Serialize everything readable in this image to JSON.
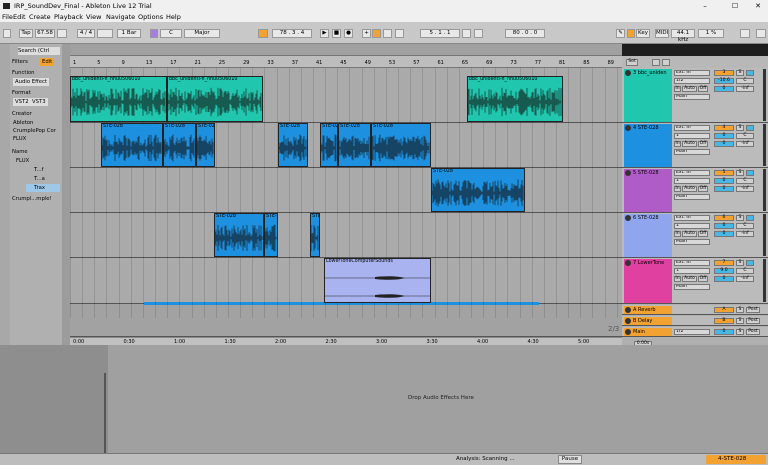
{
  "window": {
    "title": "IRP_SoundDev_Final - Ableton Live 12 Trial",
    "minimize": "–",
    "maximize": "☐",
    "close": "✕"
  },
  "menu": [
    "File",
    "Edit",
    "Create",
    "Playback",
    "View",
    "Navigate",
    "Options",
    "Help"
  ],
  "toolbar": {
    "tap": "Tap",
    "tempo": "67.58",
    "sig": "4 / 4",
    "metro": "1 Bar",
    "key": "C",
    "scale": "Major",
    "position": "78 . 3 . 4",
    "loop_start": "5 . 1 . 1",
    "loop_len": "80 . 0 . 0",
    "key_btn": "Key",
    "midi": "MIDI",
    "sample_rate": "44.1 kHz",
    "cpu": "1 %"
  },
  "browser": {
    "search": "Search (Ctrl",
    "items": [
      "Filters",
      "Edit",
      "Function",
      "Audio Effect",
      "Format",
      "VST2",
      "VST3",
      "Creator",
      "Ableton",
      "CrumplePop Cor",
      "FLUX",
      "Name",
      "FLUX",
      "T...f",
      "T...a",
      "Trax",
      "Crumpl...mple!"
    ]
  },
  "ruler_ticks": [
    "1",
    "5",
    "9",
    "13",
    "17",
    "21",
    "25",
    "29",
    "33",
    "37",
    "41",
    "45",
    "49",
    "53",
    "57",
    "61",
    "65",
    "69",
    "73",
    "77",
    "81",
    "85",
    "89"
  ],
  "timeline": [
    "0:00",
    "0:30",
    "1:00",
    "1:30",
    "2:00",
    "2:30",
    "3:00",
    "3:30",
    "4:00",
    "4:30",
    "5:00"
  ],
  "clips": {
    "c1": "bbc_unidenti-fi_nhu0506010",
    "c2": "bbc_unidenti-fi_nhu0506010",
    "c3": "bbc_unidenti-fi_nhu0506010",
    "s1": "STE-028",
    "s2": "STE-028",
    "s3": "STE-028",
    "s4": "STE-028",
    "s5": "STE-028",
    "s6": "STE-028",
    "s7": "STE-028",
    "s8": "STE-028",
    "s9": "STE-028",
    "s10": "STE-028",
    "s11": "STE",
    "low": "LowerToneComputerSounds"
  },
  "tracks": [
    {
      "name": "3 bbc_uniden",
      "color": "#20c7ae",
      "input": "Ext. In",
      "ch": "1/2",
      "mon": "Auto",
      "out": "Main",
      "num": "3",
      "vol": "-10.6",
      "pan": "C"
    },
    {
      "name": "4 STE-028",
      "color": "#1e90e0",
      "input": "Ext. In",
      "ch": "1",
      "mon": "Auto",
      "out": "Main",
      "num": "4",
      "vol": "0",
      "pan": "C"
    },
    {
      "name": "5 STE-028",
      "color": "#b05cc8",
      "input": "Ext. In",
      "ch": "1",
      "mon": "Auto",
      "out": "Main",
      "num": "5",
      "vol": "0",
      "pan": "C"
    },
    {
      "name": "6 STE-028",
      "color": "#8fa5ee",
      "input": "Ext. In",
      "ch": "1",
      "mon": "Auto",
      "out": "Main",
      "num": "6",
      "vol": "0",
      "pan": "C"
    },
    {
      "name": "7 LowerTone",
      "color": "#e040a0",
      "input": "Ext. In",
      "ch": "1",
      "mon": "Auto",
      "out": "Main",
      "num": "7",
      "vol": "9.0",
      "pan": "C"
    }
  ],
  "returns": [
    {
      "name": "A Reverb",
      "letter": "A",
      "color": "#f2a230"
    },
    {
      "name": "B Delay",
      "letter": "B",
      "color": "#f2a230"
    },
    {
      "name": "Main",
      "letter": "",
      "color": "#f2a230"
    }
  ],
  "misc": {
    "set": "Set",
    "fraction": "2/3",
    "zero": "0",
    "main_sel": "1/2",
    "oos": "0.00s",
    "solo": "S",
    "post": "Post",
    "inf": "-inf",
    "offbtn": "Off",
    "inlabel": "In"
  },
  "device": {
    "drop": "Drop Audio Effects Here"
  },
  "status": {
    "analysis": "Analysis: Scanning ...",
    "pause": "Pause",
    "track": "4-STE-028"
  }
}
